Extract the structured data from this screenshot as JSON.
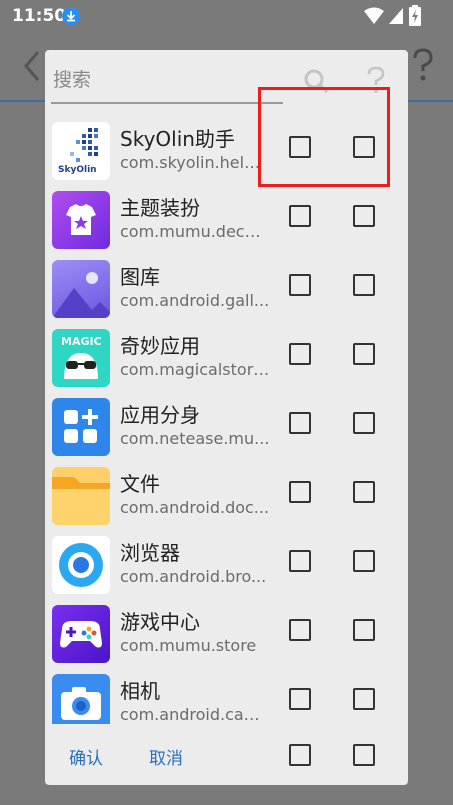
{
  "status_bar": {
    "time": "11:50"
  },
  "dialog": {
    "search_placeholder": "搜索",
    "apps": [
      {
        "name": "SkyOlin助手",
        "package": "com.skyolin.helper",
        "icon": "skyolin-icon"
      },
      {
        "name": "主题装扮",
        "package": "com.mumu.decor...",
        "icon": "theme-shirt-icon"
      },
      {
        "name": "图库",
        "package": "com.android.gall...",
        "icon": "gallery-icon"
      },
      {
        "name": "奇妙应用",
        "package": "com.magicalstory...",
        "icon": "magic-app-icon"
      },
      {
        "name": "应用分身",
        "package": "com.netease.mu...",
        "icon": "app-clone-icon"
      },
      {
        "name": "文件",
        "package": "com.android.doc...",
        "icon": "folder-icon"
      },
      {
        "name": "浏览器",
        "package": "com.android.bro...",
        "icon": "browser-icon"
      },
      {
        "name": "游戏中心",
        "package": "com.mumu.store",
        "icon": "gamepad-icon"
      },
      {
        "name": "相机",
        "package": "com.android.cam...",
        "icon": "camera-icon"
      }
    ],
    "skyolin_logo_text": "SkyOlin",
    "magic_logo_text": "MAGIC",
    "confirm_label": "确认",
    "cancel_label": "取消"
  },
  "colors": {
    "accent": "#2a6fbf",
    "highlight": "#ee1c1c"
  }
}
